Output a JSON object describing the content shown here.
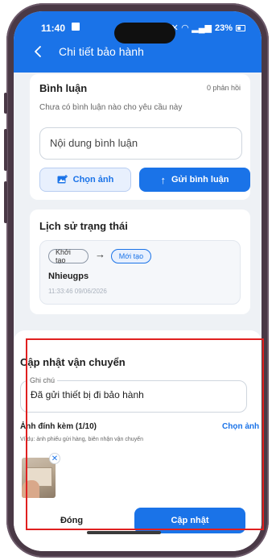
{
  "status": {
    "time": "11:40",
    "right": "23%"
  },
  "header": {
    "title": "Chi tiết bảo hành"
  },
  "comments": {
    "title": "Bình luận",
    "count": "0 phản hồi",
    "empty": "Chưa có bình luận nào cho yêu cầu này",
    "input_placeholder": "Nội dung bình luận",
    "choose_image": "Chọn ảnh",
    "send": "Gửi bình luận"
  },
  "history": {
    "title": "Lịch sử trạng thái",
    "from_status": "Khởi tạo",
    "to_status": "Mới tạo",
    "user": "Nhieugps",
    "timestamp": "11:33:46 09/06/2026"
  },
  "shipping": {
    "title": "Cập nhật vận chuyển",
    "note_label": "Ghi chú",
    "note_value": "Đã gửi thiết bị đi bảo hành",
    "attach_label": "Ảnh đính kèm (1/10)",
    "choose_image": "Chọn ảnh",
    "hint": "Ví dụ: ảnh phiếu gửi hàng, biên nhận vận chuyển",
    "close": "Đóng",
    "update": "Cập nhật"
  },
  "colors": {
    "primary": "#1a73e8",
    "highlight": "#e02020"
  }
}
